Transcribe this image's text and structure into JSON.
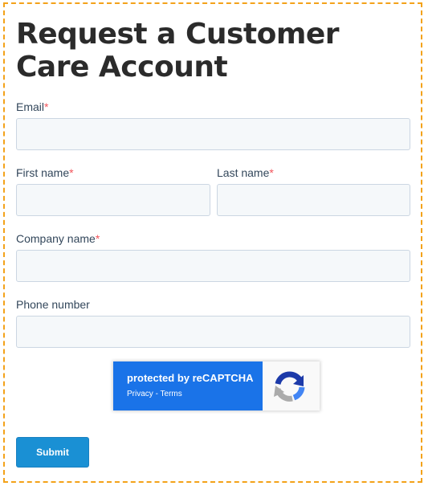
{
  "form": {
    "title": "Request a Customer Care Account",
    "required_marker": "*",
    "fields": {
      "email": {
        "label": "Email",
        "value": "",
        "required": true
      },
      "first_name": {
        "label": "First name",
        "value": "",
        "required": true
      },
      "last_name": {
        "label": "Last name",
        "value": "",
        "required": true
      },
      "company": {
        "label": "Company name",
        "value": "",
        "required": true
      },
      "phone": {
        "label": "Phone number",
        "value": "",
        "required": false
      }
    },
    "submit_label": "Submit"
  },
  "recaptcha": {
    "protected_text": "protected by reCAPTCHA",
    "privacy_label": "Privacy",
    "separator": " - ",
    "terms_label": "Terms",
    "icon": "recaptcha-logo-icon"
  },
  "colors": {
    "frame_border": "#f3a21a",
    "required_star": "#f2545b",
    "field_background": "#f5f8fa",
    "field_border": "#cbd6e2",
    "submit_background": "#1a90d4",
    "recaptcha_badge": "#1a73e8"
  }
}
